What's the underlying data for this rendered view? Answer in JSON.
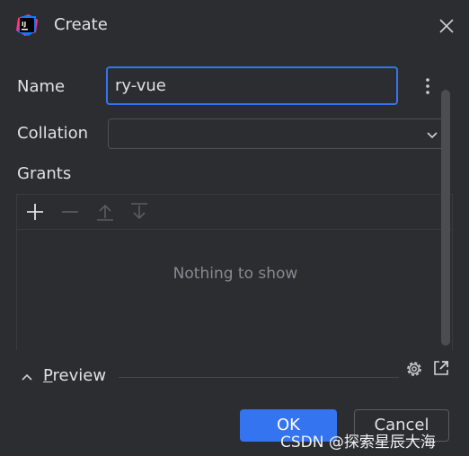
{
  "window": {
    "title": "Create",
    "icon": "intellij-idea-icon",
    "app_icon_text": "IJ"
  },
  "form": {
    "name_label": "Name",
    "name_value": "ry-vue",
    "collation_label": "Collation",
    "collation_value": "",
    "grants_label": "Grants"
  },
  "grants": {
    "toolbar": [
      "add-icon",
      "remove-icon",
      "move-up-icon",
      "move-down-icon"
    ],
    "empty_text": "Nothing to show"
  },
  "preview": {
    "label_first": "P",
    "label_rest": "review"
  },
  "buttons": {
    "ok": "OK",
    "cancel": "Cancel"
  },
  "watermark": "CSDN @探索星辰大海",
  "colors": {
    "background": "#2b2d30",
    "accent": "#3574f0",
    "text": "#dfe1e5",
    "muted": "#868a91"
  }
}
